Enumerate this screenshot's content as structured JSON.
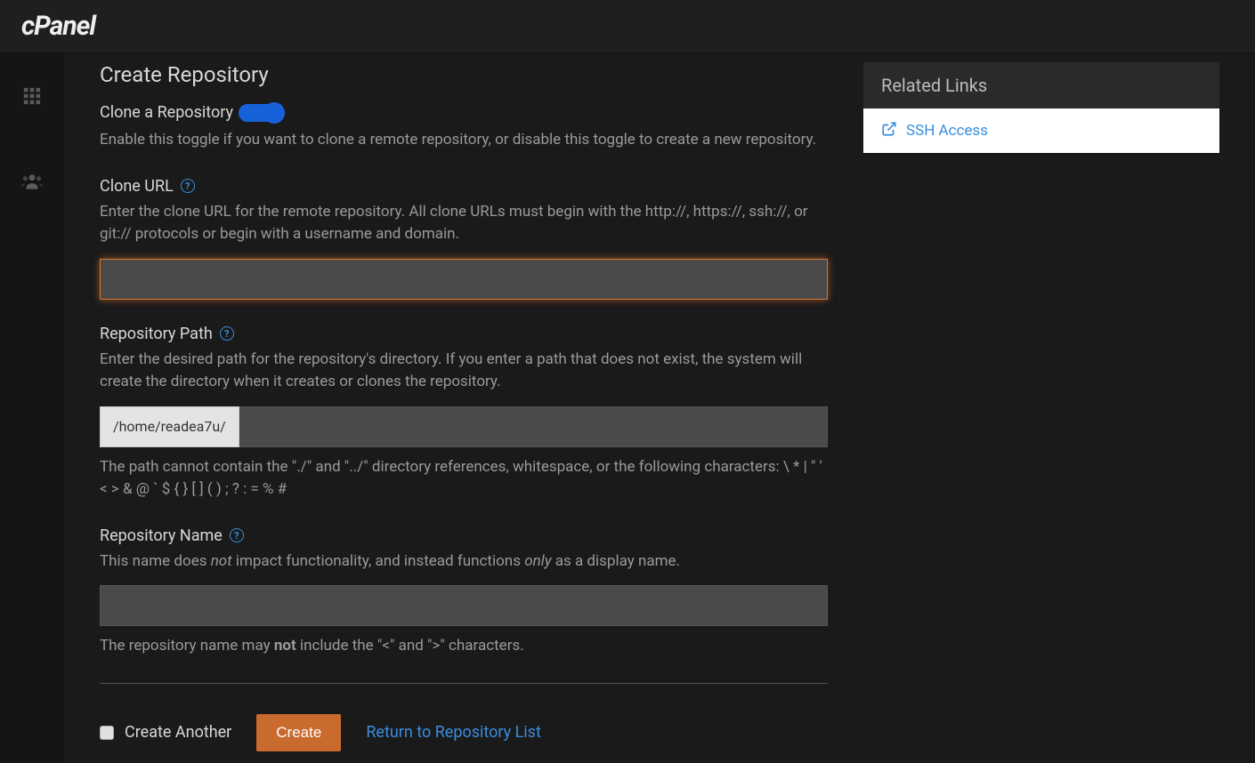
{
  "logo": "cPanel",
  "page": {
    "title": "Create Repository"
  },
  "clone": {
    "toggle_label": "Clone a Repository",
    "help": "Enable this toggle if you want to clone a remote repository, or disable this toggle to create a new repository."
  },
  "cloneurl": {
    "label": "Clone URL",
    "desc": "Enter the clone URL for the remote repository. All clone URLs must begin with the http://, https://, ssh://, or git:// protocols or begin with a username and domain."
  },
  "repopath": {
    "label": "Repository Path",
    "desc": "Enter the desired path for the repository's directory. If you enter a path that does not exist, the system will create the directory when it creates or clones the repository.",
    "prefix": "/home/readea7u/",
    "after": "The path cannot contain the \"./\" and \"../\" directory references, whitespace, or the following characters: \\ * | \" ' < > & @ ` $ { } [ ] ( ) ; ? : = % #"
  },
  "reponame": {
    "label": "Repository Name",
    "desc_prefix": "This name does ",
    "desc_not": "not",
    "desc_mid": " impact functionality, and instead functions ",
    "desc_only": "only",
    "desc_suffix": " as a display name.",
    "after_prefix": "The repository name may ",
    "after_not": "not",
    "after_suffix": " include the \"<\" and \">\" characters."
  },
  "actions": {
    "create_another": "Create Another",
    "create": "Create",
    "return": "Return to Repository List"
  },
  "related": {
    "header": "Related Links",
    "ssh": "SSH Access"
  }
}
